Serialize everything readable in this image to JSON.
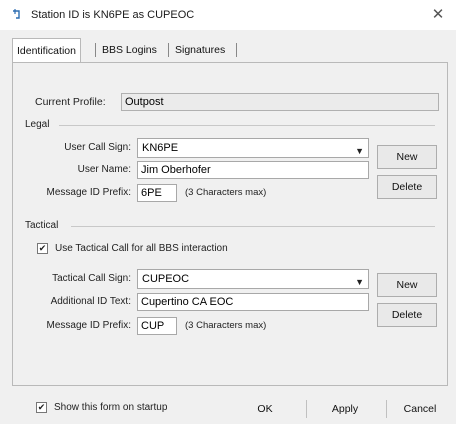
{
  "window": {
    "title": "Station ID is KN6PE as CUPEOC",
    "close_glyph": "✕"
  },
  "tabs": [
    {
      "label": "Identification",
      "active": true
    },
    {
      "label": "BBS Logins",
      "active": false
    },
    {
      "label": "Signatures",
      "active": false
    }
  ],
  "profile": {
    "label": "Current Profile:",
    "value": "Outpost"
  },
  "legal": {
    "group_label": "Legal",
    "call_sign_label": "User Call Sign:",
    "call_sign_value": "KN6PE",
    "user_name_label": "User Name:",
    "user_name_value": "Jim Oberhofer",
    "msg_prefix_label": "Message ID Prefix:",
    "msg_prefix_value": "6PE",
    "msg_prefix_hint": "(3 Characters max)",
    "new_label": "New",
    "delete_label": "Delete"
  },
  "tactical": {
    "group_label": "Tactical",
    "use_tactical_label": "Use Tactical Call for all BBS interaction",
    "use_tactical_checked": true,
    "call_sign_label": "Tactical Call Sign:",
    "call_sign_value": "CUPEOC",
    "additional_label": "Additional ID Text:",
    "additional_value": "Cupertino CA  EOC",
    "msg_prefix_label": "Message ID Prefix:",
    "msg_prefix_value": "CUP",
    "msg_prefix_hint": "(3 Characters max)",
    "new_label": "New",
    "delete_label": "Delete"
  },
  "footer": {
    "show_on_startup_label": "Show this form on startup",
    "show_on_startup_checked": true,
    "ok_label": "OK",
    "apply_label": "Apply",
    "cancel_label": "Cancel"
  },
  "glyphs": {
    "check": "✔",
    "dropdown": "▼"
  },
  "colors": {
    "window_bg": "#f0f0f0",
    "titlebar_bg": "#ffffff",
    "field_bg": "#ffffff",
    "border": "#a8a8a8"
  }
}
